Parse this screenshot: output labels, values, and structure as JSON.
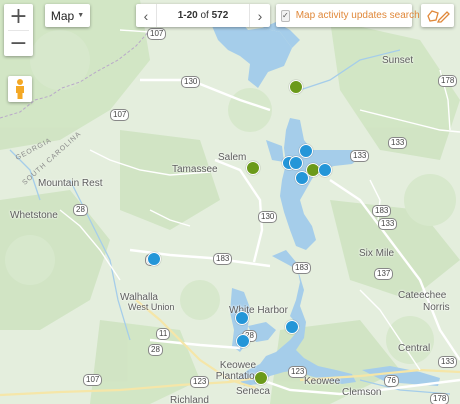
{
  "map_type": {
    "label": "Map"
  },
  "pager": {
    "range": "1-20",
    "of_word": "of",
    "total": "572"
  },
  "search_toggle": {
    "label": "Map activity updates search",
    "checked": true
  },
  "state_labels": [
    "GEORGIA",
    "SOUTH CAROLINA"
  ],
  "cities": [
    "Sunset",
    "Salem",
    "Tamassee",
    "Mountain Rest",
    "Whetstone",
    "Six Mile",
    "Walhalla",
    "West Union",
    "Cateechee",
    "Norris",
    "White Harbor",
    "Keowee Plantation",
    "Keowee",
    "Central",
    "Seneca",
    "Richland",
    "Clemson"
  ],
  "routes": [
    "107",
    "130",
    "107",
    "178",
    "133",
    "133",
    "28",
    "183",
    "183",
    "133",
    "28",
    "130",
    "11",
    "183",
    "137",
    "123",
    "28",
    "123",
    "76",
    "133",
    "107",
    "178",
    "28"
  ],
  "markers": [
    {
      "color": "green"
    },
    {
      "color": "green"
    },
    {
      "color": "green"
    },
    {
      "color": "green"
    },
    {
      "color": "blue"
    },
    {
      "color": "blue"
    },
    {
      "color": "blue"
    },
    {
      "color": "blue"
    },
    {
      "color": "blue"
    },
    {
      "color": "blue"
    },
    {
      "color": "blue"
    },
    {
      "color": "blue"
    },
    {
      "color": "blue"
    }
  ],
  "colors": {
    "water": "#a5cdea",
    "land": "#e4eedd",
    "forest": "#cfe4c2",
    "accent": "#e0883a",
    "marker_blue": "#2496d8",
    "marker_green": "#6b9a1a"
  }
}
